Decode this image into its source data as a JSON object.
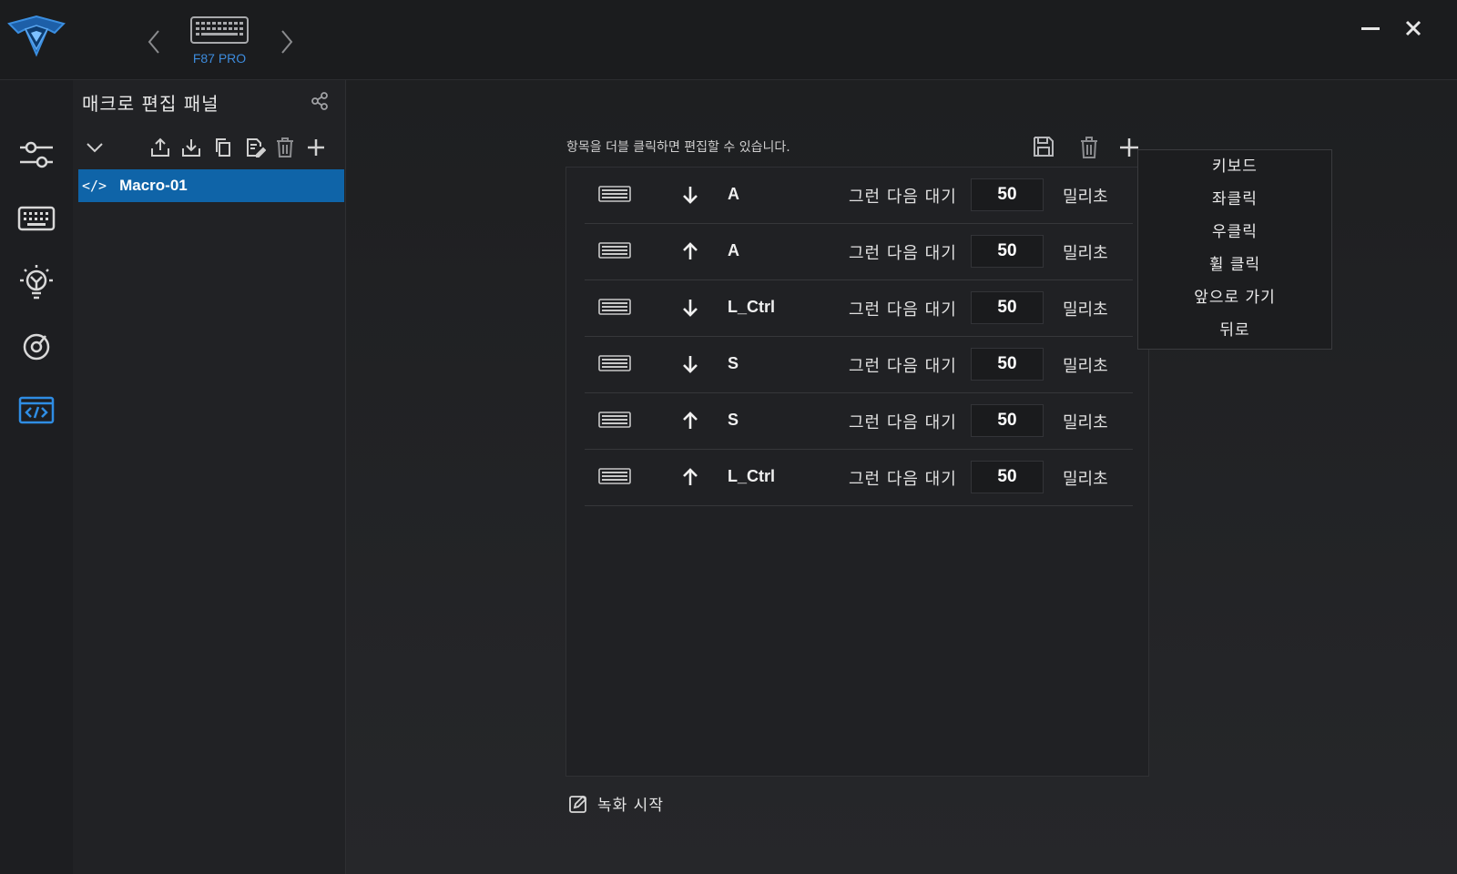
{
  "header": {
    "device_name": "F87 PRO",
    "icons": [
      "logo-icon",
      "chevron-left-icon",
      "keyboard-icon",
      "chevron-right-icon",
      "minimize-icon",
      "close-icon"
    ]
  },
  "nav": {
    "items": [
      {
        "name": "sliders-icon"
      },
      {
        "name": "keyboard-icon"
      },
      {
        "name": "lightbulb-icon"
      },
      {
        "name": "performance-icon"
      },
      {
        "name": "macro-icon",
        "active": true
      }
    ]
  },
  "panel": {
    "title": "매크로 편집 패널",
    "macros": [
      {
        "tag": "</>",
        "name": "Macro-01"
      }
    ]
  },
  "editor": {
    "hint": "항목을 더블 클릭하면 편집할 수 있습니다.",
    "rows": [
      {
        "direction": "down",
        "key": "A",
        "then_label": "그런 다음 대기",
        "delay": "50",
        "unit": "밀리초"
      },
      {
        "direction": "up",
        "key": "A",
        "then_label": "그런 다음 대기",
        "delay": "50",
        "unit": "밀리초"
      },
      {
        "direction": "down",
        "key": "L_Ctrl",
        "then_label": "그런 다음 대기",
        "delay": "50",
        "unit": "밀리초"
      },
      {
        "direction": "down",
        "key": "S",
        "then_label": "그런 다음 대기",
        "delay": "50",
        "unit": "밀리초"
      },
      {
        "direction": "up",
        "key": "S",
        "then_label": "그런 다음 대기",
        "delay": "50",
        "unit": "밀리초"
      },
      {
        "direction": "up",
        "key": "L_Ctrl",
        "then_label": "그런 다음 대기",
        "delay": "50",
        "unit": "밀리초"
      }
    ],
    "record_label": "녹화 시작"
  },
  "add_menu": {
    "items": [
      "키보드",
      "좌클릭",
      "우클릭",
      "휠 클릭",
      "앞으로 가기",
      "뒤로"
    ]
  },
  "colors": {
    "accent": "#0f64a8",
    "device_label": "#3d8bdc",
    "background": "#242528"
  }
}
